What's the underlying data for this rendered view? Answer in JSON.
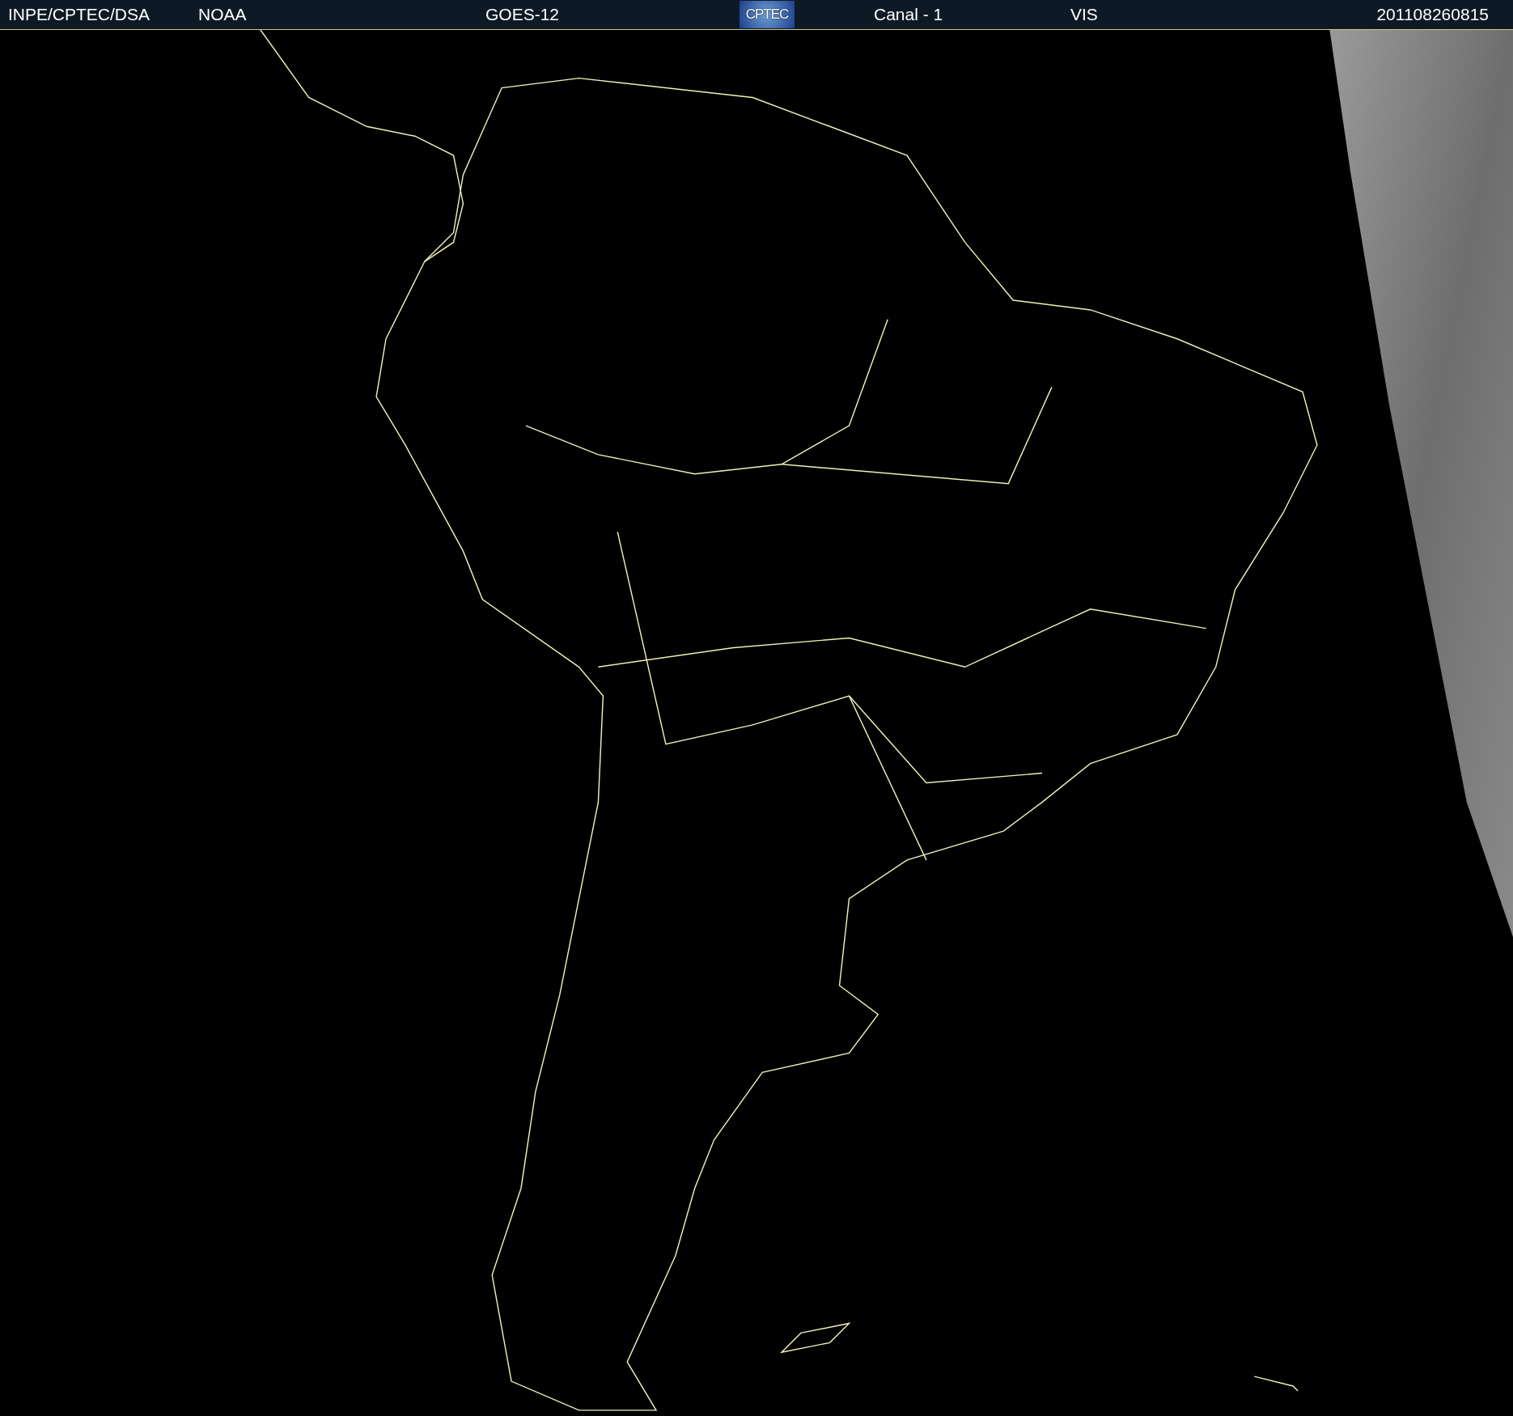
{
  "header": {
    "source": "INPE/CPTEC/DSA",
    "agency": "NOAA",
    "satellite": "GOES-12",
    "logo": "CPTEC",
    "channel": "Canal - 1",
    "band": "VIS",
    "timestamp": "201108260815"
  }
}
